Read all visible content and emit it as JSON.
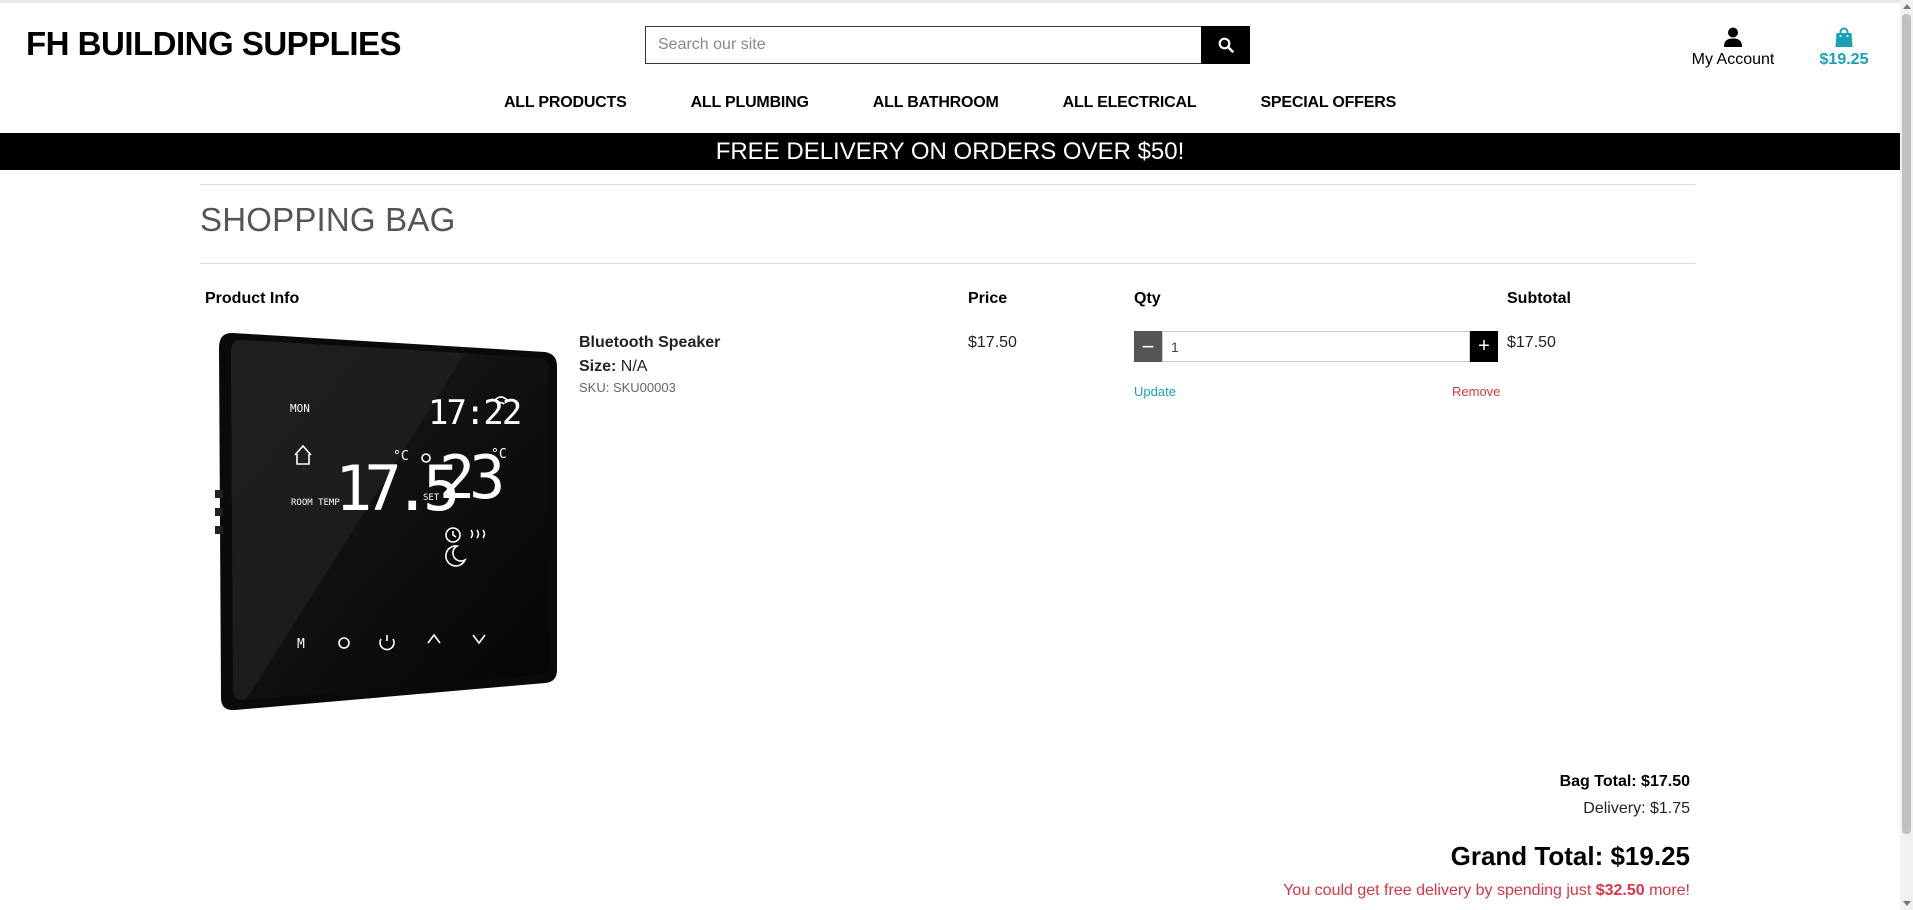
{
  "header": {
    "brand": "FH BUILDING SUPPLIES",
    "search_placeholder": "Search our site",
    "account_label": "My Account",
    "bag_total": "$19.25"
  },
  "nav": {
    "items": [
      "ALL PRODUCTS",
      "ALL PLUMBING",
      "ALL BATHROOM",
      "ALL ELECTRICAL",
      "SPECIAL OFFERS"
    ]
  },
  "banner": {
    "text": "FREE DELIVERY ON ORDERS OVER $50!"
  },
  "page": {
    "title": "SHOPPING BAG"
  },
  "table": {
    "headers": {
      "product_info": "Product Info",
      "price": "Price",
      "qty": "Qty",
      "subtotal": "Subtotal"
    },
    "items": [
      {
        "name": "Bluetooth Speaker",
        "size_label": "Size:",
        "size_value": "N/A",
        "sku": "SKU: SKU00003",
        "price": "$17.50",
        "qty": "1",
        "subtotal": "$17.50",
        "update_label": "Update",
        "remove_label": "Remove",
        "image": {
          "time": "17:22",
          "current_temp": "17.5",
          "set_temp": "23",
          "unit": "°C",
          "left_labels": [
            "MON",
            "ROOM TEMP"
          ],
          "set_label": "SET",
          "buttons": [
            "M"
          ]
        }
      }
    ]
  },
  "totals": {
    "bag_total": "Bag Total: $17.50",
    "delivery": "Delivery: $1.75",
    "grand_total": "Grand Total: $19.25",
    "free_delivery_prefix": "You could get free delivery by spending just ",
    "free_delivery_amount": "$32.50",
    "free_delivery_suffix": " more!"
  },
  "colors": {
    "accent": "#17a2b8",
    "danger": "#dc3545",
    "banner_bg": "#000000"
  },
  "icons": [
    "search-icon",
    "user-icon",
    "shopping-bag-icon",
    "minus-icon",
    "plus-icon"
  ]
}
